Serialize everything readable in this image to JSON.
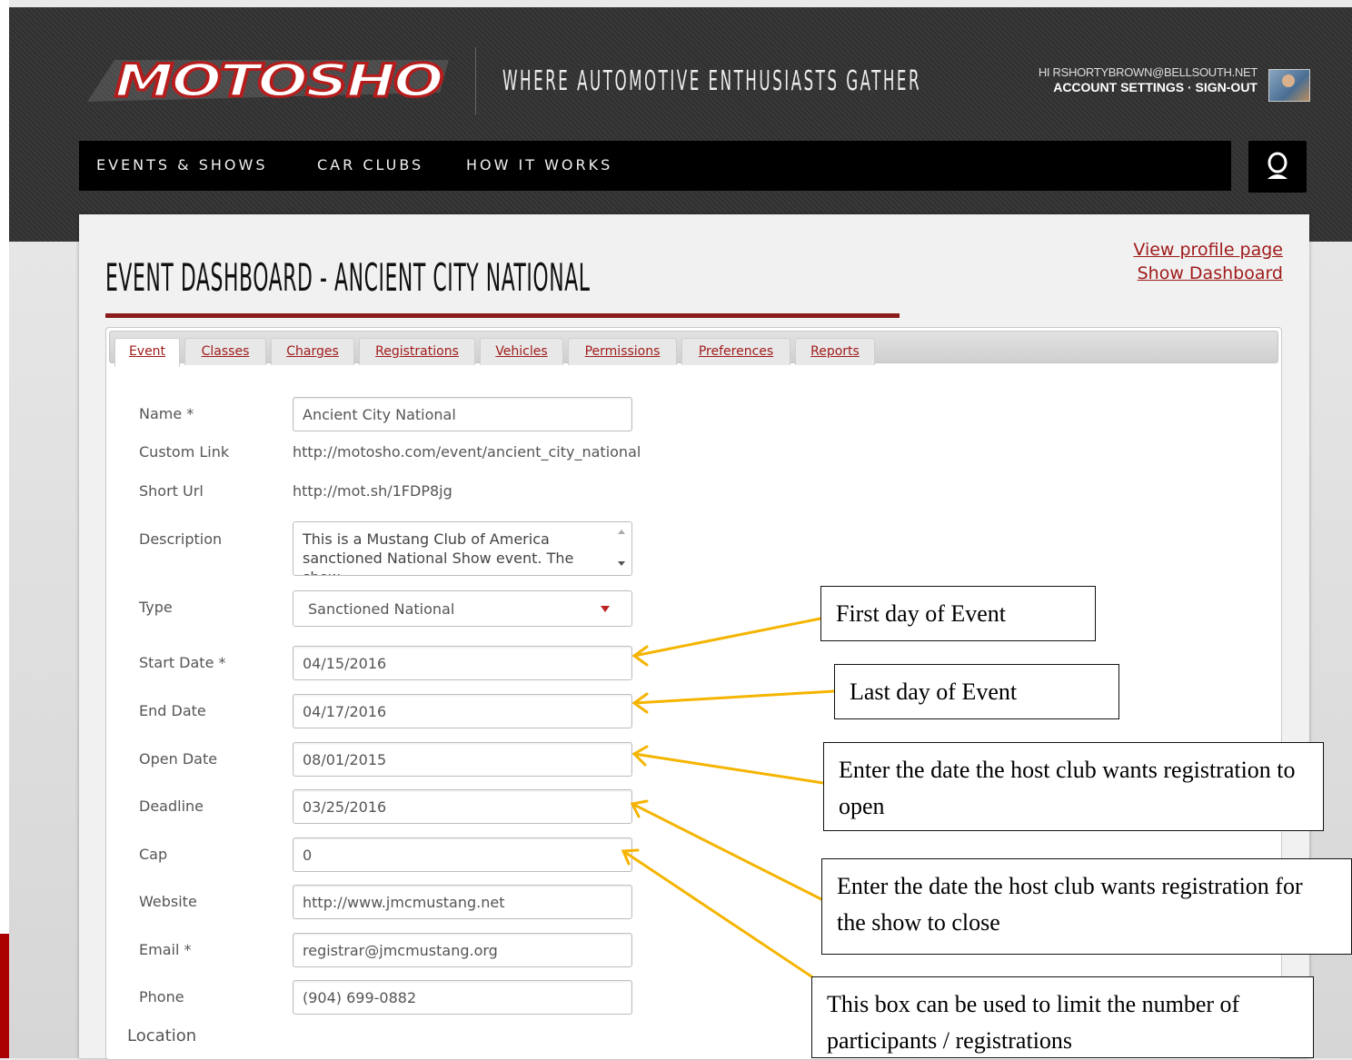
{
  "header": {
    "logo_text": "MOTOSHO",
    "tagline": "WHERE AUTOMOTIVE ENTHUSIASTS GATHER",
    "greeting": "HI RSHORTYBROWN@BELLSOUTH.NET",
    "account_settings": "ACCOUNT SETTINGS",
    "separator": "·",
    "sign_out": "SIGN-OUT"
  },
  "nav": {
    "items": [
      "EVENTS & SHOWS",
      "CAR CLUBS",
      "HOW IT WORKS"
    ]
  },
  "page": {
    "title": "EVENT DASHBOARD - ANCIENT CITY NATIONAL",
    "links": [
      "View profile page",
      "Show Dashboard"
    ]
  },
  "tabs": [
    "Event",
    "Classes",
    "Charges",
    "Registrations",
    "Vehicles",
    "Permissions",
    "Preferences",
    "Reports"
  ],
  "active_tab": "Event",
  "form": {
    "name_label": "Name *",
    "name_value": "Ancient City National",
    "custom_link_label": "Custom Link",
    "custom_link_value": "http://motosho.com/event/ancient_city_national",
    "short_url_label": "Short Url",
    "short_url_value": "http://mot.sh/1FDP8jg",
    "description_label": "Description",
    "description_value": "This is a Mustang Club of America sanctioned National Show event. The show...",
    "type_label": "Type",
    "type_value": "Sanctioned National",
    "start_date_label": "Start Date *",
    "start_date_value": "04/15/2016",
    "end_date_label": "End Date",
    "end_date_value": "04/17/2016",
    "open_date_label": "Open Date",
    "open_date_value": "08/01/2015",
    "deadline_label": "Deadline",
    "deadline_value": "03/25/2016",
    "cap_label": "Cap",
    "cap_value": "0",
    "website_label": "Website",
    "website_value": "http://www.jmcmustang.net",
    "email_label": "Email *",
    "email_value": "registrar@jmcmustang.org",
    "phone_label": "Phone",
    "phone_value": "(904) 699-0882",
    "location_label": "Location"
  },
  "annotations": {
    "first_day": "First day of Event",
    "last_day": "Last day of Event",
    "open_note": "Enter the date the host club wants registration to open",
    "close_note": "Enter the date the host club wants registration for the show to close",
    "cap_note": "This box can be used to limit the number of participants / registrations"
  },
  "colors": {
    "accent_red": "#a01b1b",
    "arrow": "#f5b400",
    "nav_bg": "#000000"
  }
}
